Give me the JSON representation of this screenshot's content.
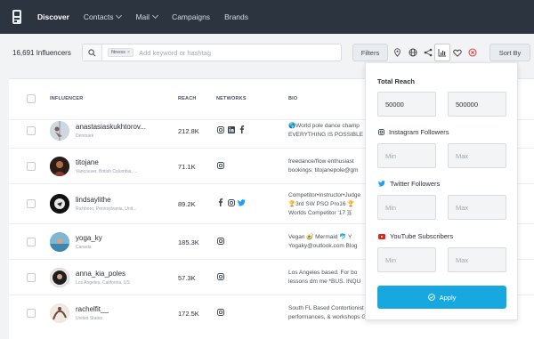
{
  "colors": {
    "nav_bg": "#2c3440",
    "accent": "#17a8e0",
    "page_bg": "#f2f3f5"
  },
  "nav": {
    "items": [
      {
        "label": "Discover",
        "active": true,
        "dropdown": false
      },
      {
        "label": "Contacts",
        "active": false,
        "dropdown": true
      },
      {
        "label": "Mail",
        "active": false,
        "dropdown": true
      },
      {
        "label": "Campaigns",
        "active": false,
        "dropdown": false
      },
      {
        "label": "Brands",
        "active": false,
        "dropdown": false
      }
    ]
  },
  "toolbar": {
    "count_label": "16,691 Influencers",
    "chip_label": "fitness",
    "chip_remove": "×",
    "search_placeholder": "Add keyword or hashtag",
    "filters_label": "Filters",
    "icons": [
      "location-pin-icon",
      "globe-icon",
      "share-icon",
      "bar-chart-icon",
      "heart-icon",
      "close-circle-icon"
    ],
    "sort_label": "Sort By"
  },
  "table": {
    "headers": {
      "influencer": "INFLUENCER",
      "reach": "REACH",
      "networks": "NETWORKS",
      "bio": "BIO"
    },
    "rows": [
      {
        "name": "anastasiaskukhtorov...",
        "location": "Denmark",
        "reach": "212.8K",
        "networks": [
          "instagram",
          "linkedin",
          "facebook"
        ],
        "bio1": "🌎World pole dance champ",
        "bio2": "EVERYTHING IS POSSIBLE",
        "avatar_color": "#c9d3dc"
      },
      {
        "name": "titojane",
        "location": "Vancouver, British Columbia, ...",
        "reach": "71.1K",
        "networks": [
          "instagram"
        ],
        "bio1": "freedance/flow enthusiast",
        "bio2": "bookings: titojanepole@gm",
        "avatar_color": "#3a2a22"
      },
      {
        "name": "lindsaylithe",
        "location": "Richboro, Pennsylvania, Unit...",
        "reach": "89.2K",
        "networks": [
          "facebook",
          "instagram",
          "twitter"
        ],
        "bio1": "Competitor•Instructor•Judge",
        "bio2": "🏆3rd SW PSO Pro16 🏆",
        "bio3": "Worlds Competitor '17 🇧",
        "avatar_color": "#1d1d1d"
      },
      {
        "name": "yoga_ky",
        "location": "Canada",
        "reach": "185.3K",
        "networks": [
          "instagram"
        ],
        "bio1": "Vegan 🥑 Mermaid 🐬 Y",
        "bio2": "Yogaky@outlook.com Blog",
        "avatar_color": "#6fa8c8"
      },
      {
        "name": "anna_kia_poles",
        "location": "Los Angeles, California, US",
        "reach": "57.3K",
        "networks": [
          "instagram"
        ],
        "bio1": "Los Angeles based. For bo",
        "bio2": "lessons dm me *BUS. INQU",
        "avatar_color": "#2a2a2a"
      },
      {
        "name": "rachelfit__",
        "location": "United States",
        "reach": "172.5K",
        "networks": [
          "instagram"
        ],
        "bio1": "South FL Based Contortionist",
        "bio2": "performances, & workshops Group Classes in Hollywood FL",
        "avatar_color": "#d7c9b8"
      }
    ]
  },
  "filter_panel": {
    "total_reach_title": "Total Reach",
    "total_reach_min_value": "50000",
    "total_reach_max_value": "500000",
    "instagram_title": "Instagram Followers",
    "twitter_title": "Twitter Followers",
    "youtube_title": "YouTube Subscribers",
    "min_placeholder": "Min",
    "max_placeholder": "Max",
    "apply_label": "Apply"
  }
}
